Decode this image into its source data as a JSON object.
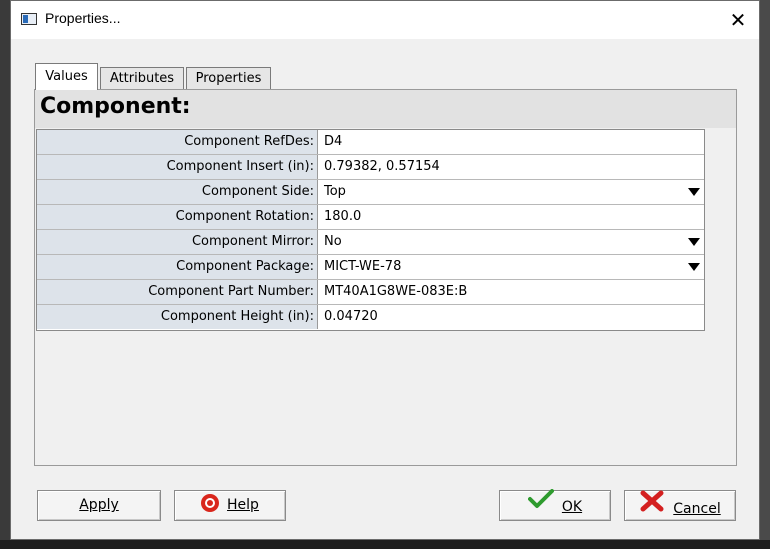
{
  "window": {
    "title": "Properties...",
    "close_icon": "close-icon"
  },
  "tabs": [
    {
      "label": "Values",
      "active": true
    },
    {
      "label": "Attributes",
      "active": false
    },
    {
      "label": "Properties",
      "active": false
    }
  ],
  "panel": {
    "title": "Component:"
  },
  "fields": [
    {
      "label": "Component RefDes:",
      "value": "D4",
      "dropdown": false
    },
    {
      "label": "Component Insert (in):",
      "value": "0.79382, 0.57154",
      "dropdown": false
    },
    {
      "label": "Component Side:",
      "value": "Top",
      "dropdown": true
    },
    {
      "label": "Component Rotation:",
      "value": "180.0",
      "dropdown": false
    },
    {
      "label": "Component Mirror:",
      "value": "No",
      "dropdown": true
    },
    {
      "label": "Component Package:",
      "value": "MICT-WE-78",
      "dropdown": true
    },
    {
      "label": "Component Part Number:",
      "value": "MT40A1G8WE-083E:B",
      "dropdown": false
    },
    {
      "label": "Component Height (in):",
      "value": "0.04720",
      "dropdown": false
    }
  ],
  "buttons": {
    "apply": "Apply",
    "help": "Help",
    "ok": "OK",
    "cancel": "Cancel"
  },
  "colors": {
    "label_bg": "#dde3ea",
    "ok_check": "#2e9b2e",
    "cancel_x": "#d42020",
    "help_icon": "#d9261c"
  }
}
